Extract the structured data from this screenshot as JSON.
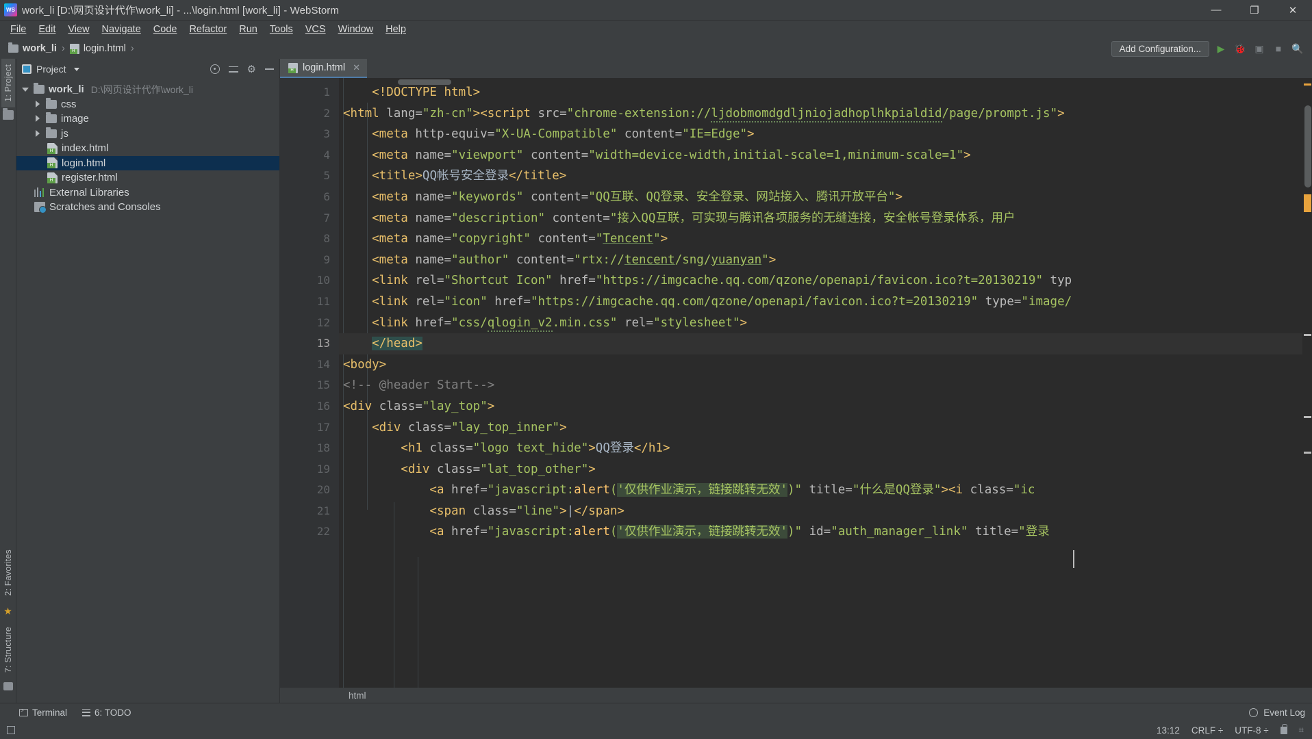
{
  "window": {
    "title": "work_li [D:\\网页设计代作\\work_li] - ...\\login.html [work_li] - WebStorm",
    "logo": "webstorm-logo",
    "minimize": "—",
    "maximize": "❐",
    "close": "✕"
  },
  "menubar": {
    "items": [
      {
        "label": "File"
      },
      {
        "label": "Edit"
      },
      {
        "label": "View"
      },
      {
        "label": "Navigate"
      },
      {
        "label": "Code"
      },
      {
        "label": "Refactor"
      },
      {
        "label": "Run"
      },
      {
        "label": "Tools"
      },
      {
        "label": "VCS"
      },
      {
        "label": "Window"
      },
      {
        "label": "Help"
      }
    ]
  },
  "navbar": {
    "breadcrumbs": [
      {
        "label": "work_li",
        "icon": "folder-icon"
      },
      {
        "label": "login.html",
        "icon": "html-file-icon"
      }
    ],
    "add_configuration": "Add Configuration...",
    "icons": [
      "run-icon",
      "debug-icon",
      "coverage-icon",
      "stop-icon",
      "search-icon"
    ]
  },
  "left_strip": {
    "tabs": [
      {
        "label": "1: Project",
        "active": true
      },
      {
        "label": "2: Favorites",
        "active": false
      },
      {
        "label": "7: Structure",
        "active": false
      }
    ]
  },
  "project_panel": {
    "title": "Project",
    "actions": [
      "locate-icon",
      "collapse-all-icon",
      "gear-icon",
      "hide-icon"
    ],
    "tree": [
      {
        "label": "work_li",
        "path": "D:\\网页设计代作\\work_li",
        "icon": "folder-icon",
        "arrow": "down",
        "depth": 0,
        "bold": true,
        "selected": false
      },
      {
        "label": "css",
        "path": "",
        "icon": "folder-icon",
        "arrow": "right",
        "depth": 1,
        "bold": false,
        "selected": false
      },
      {
        "label": "image",
        "path": "",
        "icon": "folder-icon",
        "arrow": "right",
        "depth": 1,
        "bold": false,
        "selected": false
      },
      {
        "label": "js",
        "path": "",
        "icon": "folder-icon",
        "arrow": "right",
        "depth": 1,
        "bold": false,
        "selected": false
      },
      {
        "label": "index.html",
        "path": "",
        "icon": "html-file-icon",
        "arrow": "none",
        "depth": 2,
        "bold": false,
        "selected": false
      },
      {
        "label": "login.html",
        "path": "",
        "icon": "html-file-icon",
        "arrow": "none",
        "depth": 2,
        "bold": false,
        "selected": true
      },
      {
        "label": "register.html",
        "path": "",
        "icon": "html-file-icon",
        "arrow": "none",
        "depth": 2,
        "bold": false,
        "selected": false
      },
      {
        "label": "External Libraries",
        "path": "",
        "icon": "external-libraries-icon",
        "arrow": "none",
        "depth": 0,
        "bold": false,
        "selected": false
      },
      {
        "label": "Scratches and Consoles",
        "path": "",
        "icon": "scratches-icon",
        "arrow": "none",
        "depth": 0,
        "bold": false,
        "selected": false
      }
    ]
  },
  "editor": {
    "tab": {
      "label": "login.html",
      "icon": "html-file-icon",
      "close": "✕"
    },
    "breadcrumb": "html",
    "line_numbers": [
      1,
      2,
      3,
      4,
      5,
      6,
      7,
      8,
      9,
      10,
      11,
      12,
      13,
      14,
      15,
      16,
      17,
      18,
      19,
      20,
      21,
      22
    ],
    "current_line": 13,
    "lines": [
      {
        "n": 1,
        "indent": "    ",
        "segments": [
          {
            "t": "tag",
            "v": "<!DOCTYPE html>"
          }
        ]
      },
      {
        "n": 2,
        "indent": "",
        "segments": [
          {
            "t": "tag",
            "v": "<html "
          },
          {
            "t": "attr",
            "v": "lang="
          },
          {
            "t": "val",
            "v": "\"zh-cn\""
          },
          {
            "t": "tag",
            "v": "><script "
          },
          {
            "t": "attr",
            "v": "src="
          },
          {
            "t": "val",
            "v": "\"chrome-extension://"
          },
          {
            "t": "val-wavy",
            "v": "ljdobmomdgdljniojadhoplhkpialdid"
          },
          {
            "t": "val",
            "v": "/page/prompt.js\""
          },
          {
            "t": "tag",
            "v": ">"
          }
        ]
      },
      {
        "n": 3,
        "indent": "    ",
        "segments": [
          {
            "t": "tag",
            "v": "<meta "
          },
          {
            "t": "attr",
            "v": "http-equiv="
          },
          {
            "t": "val",
            "v": "\"X-UA-Compatible\""
          },
          {
            "t": "attr",
            "v": " content="
          },
          {
            "t": "val",
            "v": "\"IE=Edge\""
          },
          {
            "t": "tag",
            "v": ">"
          }
        ]
      },
      {
        "n": 4,
        "indent": "    ",
        "segments": [
          {
            "t": "tag",
            "v": "<meta "
          },
          {
            "t": "attr",
            "v": "name="
          },
          {
            "t": "val",
            "v": "\"viewport\""
          },
          {
            "t": "attr",
            "v": " content="
          },
          {
            "t": "val",
            "v": "\"width=device-width,initial-scale=1,minimum-scale=1\""
          },
          {
            "t": "tag",
            "v": ">"
          }
        ]
      },
      {
        "n": 5,
        "indent": "    ",
        "segments": [
          {
            "t": "tag",
            "v": "<title>"
          },
          {
            "t": "txt",
            "v": "QQ帐号安全登录"
          },
          {
            "t": "tag",
            "v": "</title>"
          }
        ]
      },
      {
        "n": 6,
        "indent": "    ",
        "segments": [
          {
            "t": "tag",
            "v": "<meta "
          },
          {
            "t": "attr",
            "v": "name="
          },
          {
            "t": "val",
            "v": "\"keywords\""
          },
          {
            "t": "attr",
            "v": " content="
          },
          {
            "t": "val",
            "v": "\"QQ互联、QQ登录、安全登录、网站接入、腾讯开放平台\""
          },
          {
            "t": "tag",
            "v": ">"
          }
        ]
      },
      {
        "n": 7,
        "indent": "    ",
        "segments": [
          {
            "t": "tag",
            "v": "<meta "
          },
          {
            "t": "attr",
            "v": "name="
          },
          {
            "t": "val",
            "v": "\"description\""
          },
          {
            "t": "attr",
            "v": " content="
          },
          {
            "t": "val",
            "v": "\"接入QQ互联，可实现与腾讯各项服务的无缝连接，安全帐号登录体系，用户"
          }
        ]
      },
      {
        "n": 8,
        "indent": "    ",
        "segments": [
          {
            "t": "tag",
            "v": "<meta "
          },
          {
            "t": "attr",
            "v": "name="
          },
          {
            "t": "val",
            "v": "\"copyright\""
          },
          {
            "t": "attr",
            "v": " content="
          },
          {
            "t": "val",
            "v": "\""
          },
          {
            "t": "val-uline",
            "v": "Tencent"
          },
          {
            "t": "val",
            "v": "\""
          },
          {
            "t": "tag",
            "v": ">"
          }
        ]
      },
      {
        "n": 9,
        "indent": "    ",
        "segments": [
          {
            "t": "tag",
            "v": "<meta "
          },
          {
            "t": "attr",
            "v": "name="
          },
          {
            "t": "val",
            "v": "\"author\""
          },
          {
            "t": "attr",
            "v": " content="
          },
          {
            "t": "val",
            "v": "\"rtx://"
          },
          {
            "t": "val-uline",
            "v": "tencent"
          },
          {
            "t": "val",
            "v": "/sng/"
          },
          {
            "t": "val-uline",
            "v": "yuanyan"
          },
          {
            "t": "val",
            "v": "\""
          },
          {
            "t": "tag",
            "v": ">"
          }
        ]
      },
      {
        "n": 10,
        "indent": "    ",
        "segments": [
          {
            "t": "tag",
            "v": "<link "
          },
          {
            "t": "attr",
            "v": "rel="
          },
          {
            "t": "val",
            "v": "\"Shortcut Icon\""
          },
          {
            "t": "attr",
            "v": " href="
          },
          {
            "t": "val",
            "v": "\"https://imgcache.qq.com/qzone/openapi/favicon.ico?t=20130219\""
          },
          {
            "t": "attr",
            "v": " typ"
          }
        ]
      },
      {
        "n": 11,
        "indent": "    ",
        "segments": [
          {
            "t": "tag",
            "v": "<link "
          },
          {
            "t": "attr",
            "v": "rel="
          },
          {
            "t": "val",
            "v": "\"icon\""
          },
          {
            "t": "attr",
            "v": " href="
          },
          {
            "t": "val",
            "v": "\"https://imgcache.qq.com/qzone/openapi/favicon.ico?t=20130219\""
          },
          {
            "t": "attr",
            "v": " type="
          },
          {
            "t": "val",
            "v": "\"image/"
          }
        ]
      },
      {
        "n": 12,
        "indent": "    ",
        "segments": [
          {
            "t": "tag",
            "v": "<link "
          },
          {
            "t": "attr",
            "v": "href="
          },
          {
            "t": "val",
            "v": "\"css/"
          },
          {
            "t": "val-wavy",
            "v": "qlogin_v2"
          },
          {
            "t": "val",
            "v": ".min.css\""
          },
          {
            "t": "attr",
            "v": " rel="
          },
          {
            "t": "val",
            "v": "\"stylesheet\""
          },
          {
            "t": "tag",
            "v": ">"
          }
        ]
      },
      {
        "n": 13,
        "indent": "    ",
        "segments": [
          {
            "t": "tag-headsel",
            "v": "</head>"
          }
        ]
      },
      {
        "n": 14,
        "indent": "",
        "segments": [
          {
            "t": "tag",
            "v": "<body>"
          }
        ]
      },
      {
        "n": 15,
        "indent": "",
        "segments": [
          {
            "t": "comment",
            "v": "<!-- @header Start-->"
          }
        ]
      },
      {
        "n": 16,
        "indent": "",
        "segments": [
          {
            "t": "tag",
            "v": "<div "
          },
          {
            "t": "attr",
            "v": "class="
          },
          {
            "t": "val",
            "v": "\"lay_top\""
          },
          {
            "t": "tag",
            "v": ">"
          }
        ]
      },
      {
        "n": 17,
        "indent": "    ",
        "segments": [
          {
            "t": "tag",
            "v": "<div "
          },
          {
            "t": "attr",
            "v": "class="
          },
          {
            "t": "val",
            "v": "\"lay_top_inner\""
          },
          {
            "t": "tag",
            "v": ">"
          }
        ]
      },
      {
        "n": 18,
        "indent": "        ",
        "segments": [
          {
            "t": "tag",
            "v": "<h1 "
          },
          {
            "t": "attr",
            "v": "class="
          },
          {
            "t": "val",
            "v": "\"logo text_hide\""
          },
          {
            "t": "tag",
            "v": ">"
          },
          {
            "t": "txt",
            "v": "QQ登录"
          },
          {
            "t": "tag",
            "v": "</h1>"
          }
        ]
      },
      {
        "n": 19,
        "indent": "        ",
        "segments": [
          {
            "t": "tag",
            "v": "<div "
          },
          {
            "t": "attr",
            "v": "class="
          },
          {
            "t": "val",
            "v": "\"lat_top_other\""
          },
          {
            "t": "tag",
            "v": ">"
          }
        ]
      },
      {
        "n": 20,
        "indent": "            ",
        "segments": [
          {
            "t": "tag",
            "v": "<a "
          },
          {
            "t": "attr",
            "v": "href="
          },
          {
            "t": "val",
            "v": "\"javascript:"
          },
          {
            "t": "fn",
            "v": "alert"
          },
          {
            "t": "val",
            "v": "("
          },
          {
            "t": "val-strsel",
            "v": "'仅供作业演示，链接跳转无效'"
          },
          {
            "t": "val",
            "v": ")\""
          },
          {
            "t": "attr",
            "v": " title="
          },
          {
            "t": "val",
            "v": "\"什么是QQ登录\""
          },
          {
            "t": "tag",
            "v": "><i "
          },
          {
            "t": "attr",
            "v": "class="
          },
          {
            "t": "val",
            "v": "\"ic"
          }
        ]
      },
      {
        "n": 21,
        "indent": "            ",
        "segments": [
          {
            "t": "tag",
            "v": "<span "
          },
          {
            "t": "attr",
            "v": "class="
          },
          {
            "t": "val",
            "v": "\"line\""
          },
          {
            "t": "tag",
            "v": ">"
          },
          {
            "t": "txt",
            "v": "|"
          },
          {
            "t": "tag",
            "v": "</span>"
          }
        ]
      },
      {
        "n": 22,
        "indent": "            ",
        "segments": [
          {
            "t": "tag",
            "v": "<a "
          },
          {
            "t": "attr",
            "v": "href="
          },
          {
            "t": "val",
            "v": "\"javascript:"
          },
          {
            "t": "fn",
            "v": "alert"
          },
          {
            "t": "val",
            "v": "("
          },
          {
            "t": "val-strsel",
            "v": "'仅供作业演示，链接跳转无效'"
          },
          {
            "t": "val",
            "v": ")\""
          },
          {
            "t": "attr",
            "v": " id="
          },
          {
            "t": "val",
            "v": "\"auth_manager_link\""
          },
          {
            "t": "attr",
            "v": " title="
          },
          {
            "t": "val",
            "v": "\"登录"
          }
        ]
      }
    ]
  },
  "bottombar": {
    "items": [
      {
        "label": "Terminal",
        "icon": "terminal-icon"
      },
      {
        "label": "6: TODO",
        "icon": "todo-icon"
      }
    ],
    "event_log": "Event Log",
    "event_log_icon": "event-log-icon"
  },
  "statusbar": {
    "time": "13:12",
    "line_separator_label": "CRLF",
    "line_separator": "CRLF ÷",
    "encoding": "UTF-8 ÷",
    "lock_icon": "lock-icon",
    "brace_icon": "brace-icon"
  },
  "colors": {
    "background": "#3c3f41",
    "editor_bg": "#2b2b2b",
    "gutter_bg": "#313335",
    "selection": "#0d2f4f",
    "tag": "#e8bf6a",
    "attr": "#bababa",
    "value": "#a5c261",
    "comment": "#808080",
    "function": "#ffc66d",
    "text": "#a9b7c6",
    "head_selection": "#2f4f4b",
    "string_selection": "#3c4b3a",
    "tab_underline": "#4e7ba8"
  }
}
